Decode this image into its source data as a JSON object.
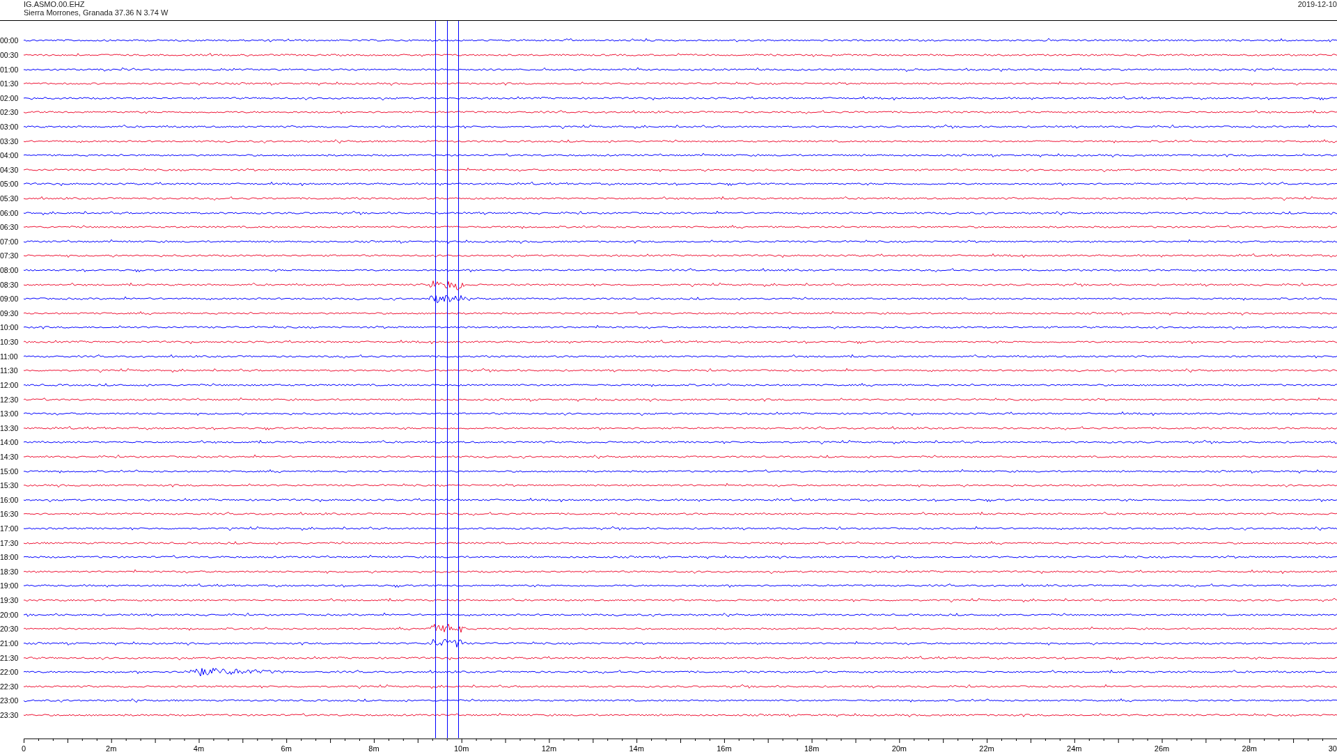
{
  "header": {
    "channel": "IG.ASMO.00.EHZ",
    "station": "Sierra Morrones, Granada  37.36 N 3.74 W",
    "date": "2019-12-10"
  },
  "traces": [
    {
      "time": "00:00",
      "color": "#0000ff"
    },
    {
      "time": "00:30",
      "color": "#ee1133"
    },
    {
      "time": "01:00",
      "color": "#0000ff"
    },
    {
      "time": "01:30",
      "color": "#ee1133"
    },
    {
      "time": "02:00",
      "color": "#0000ff"
    },
    {
      "time": "02:30",
      "color": "#ee1133"
    },
    {
      "time": "03:00",
      "color": "#0000ff"
    },
    {
      "time": "03:30",
      "color": "#ee1133"
    },
    {
      "time": "04:00",
      "color": "#0000ff"
    },
    {
      "time": "04:30",
      "color": "#ee1133"
    },
    {
      "time": "05:00",
      "color": "#0000ff"
    },
    {
      "time": "05:30",
      "color": "#ee1133"
    },
    {
      "time": "06:00",
      "color": "#0000ff"
    },
    {
      "time": "06:30",
      "color": "#ee1133"
    },
    {
      "time": "07:00",
      "color": "#0000ff"
    },
    {
      "time": "07:30",
      "color": "#ee1133"
    },
    {
      "time": "08:00",
      "color": "#0000ff"
    },
    {
      "time": "08:30",
      "color": "#ee1133"
    },
    {
      "time": "09:00",
      "color": "#0000ff"
    },
    {
      "time": "09:30",
      "color": "#ee1133"
    },
    {
      "time": "10:00",
      "color": "#0000ff"
    },
    {
      "time": "10:30",
      "color": "#ee1133"
    },
    {
      "time": "11:00",
      "color": "#0000ff"
    },
    {
      "time": "11:30",
      "color": "#ee1133"
    },
    {
      "time": "12:00",
      "color": "#0000ff"
    },
    {
      "time": "12:30",
      "color": "#ee1133"
    },
    {
      "time": "13:00",
      "color": "#0000ff"
    },
    {
      "time": "13:30",
      "color": "#ee1133"
    },
    {
      "time": "14:00",
      "color": "#0000ff"
    },
    {
      "time": "14:30",
      "color": "#ee1133"
    },
    {
      "time": "15:00",
      "color": "#0000ff"
    },
    {
      "time": "15:30",
      "color": "#ee1133"
    },
    {
      "time": "16:00",
      "color": "#0000ff"
    },
    {
      "time": "16:30",
      "color": "#ee1133"
    },
    {
      "time": "17:00",
      "color": "#0000ff"
    },
    {
      "time": "17:30",
      "color": "#ee1133"
    },
    {
      "time": "18:00",
      "color": "#0000ff"
    },
    {
      "time": "18:30",
      "color": "#ee1133"
    },
    {
      "time": "19:00",
      "color": "#0000ff"
    },
    {
      "time": "19:30",
      "color": "#ee1133"
    },
    {
      "time": "20:00",
      "color": "#0000ff"
    },
    {
      "time": "20:30",
      "color": "#ee1133"
    },
    {
      "time": "21:00",
      "color": "#0000ff"
    },
    {
      "time": "21:30",
      "color": "#ee1133"
    },
    {
      "time": "22:00",
      "color": "#0000ff"
    },
    {
      "time": "22:30",
      "color": "#ee1133"
    },
    {
      "time": "23:00",
      "color": "#0000ff"
    },
    {
      "time": "23:30",
      "color": "#ee1133"
    }
  ],
  "x_axis": {
    "labels": [
      "0",
      "2m",
      "4m",
      "6m",
      "8m",
      "10m",
      "12m",
      "14m",
      "16m",
      "18m",
      "20m",
      "22m",
      "24m",
      "26m",
      "28m",
      "30"
    ]
  }
}
